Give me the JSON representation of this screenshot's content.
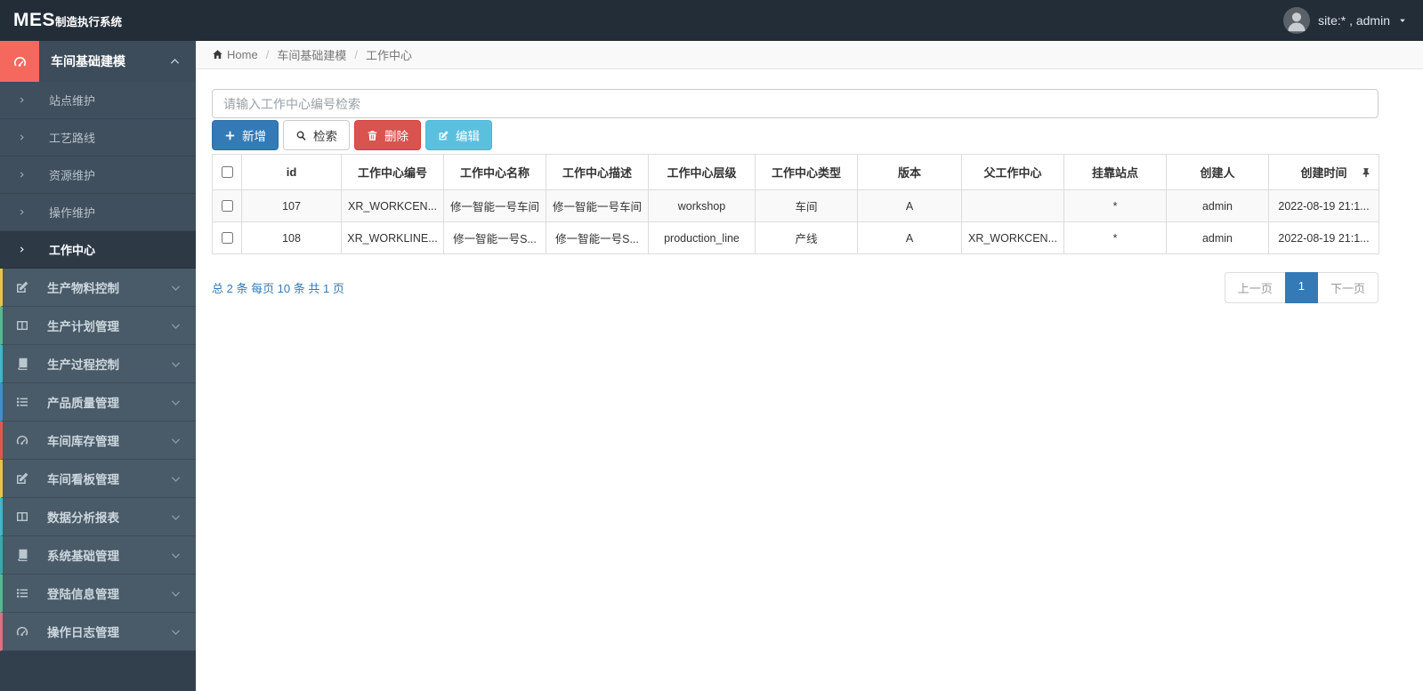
{
  "colors": {
    "primary": "#337ab7",
    "danger": "#d9534f",
    "info": "#5bc0de",
    "sidebar_active_icon": "#f4685e"
  },
  "navbar": {
    "logo_primary": "MES",
    "logo_secondary": "制造执行系统",
    "user_label": "site:* , admin"
  },
  "sidebar": {
    "parent_active": {
      "label": "车间基础建模"
    },
    "sub_items": [
      {
        "label": "站点维护",
        "active": false
      },
      {
        "label": "工艺路线",
        "active": false
      },
      {
        "label": "资源维护",
        "active": false
      },
      {
        "label": "操作维护",
        "active": false
      },
      {
        "label": "工作中心",
        "active": true
      }
    ],
    "menu_items": [
      {
        "label": "生产物料控制",
        "icon": "pencil-square-icon",
        "accent": "#e8c444"
      },
      {
        "label": "生产计划管理",
        "icon": "columns-icon",
        "accent": "#56b88d"
      },
      {
        "label": "生产过程控制",
        "icon": "book-icon",
        "accent": "#3fb6c9"
      },
      {
        "label": "产品质量管理",
        "icon": "list-icon",
        "accent": "#3f8fc9"
      },
      {
        "label": "车间库存管理",
        "icon": "gauge-icon",
        "accent": "#e2574c"
      },
      {
        "label": "车间看板管理",
        "icon": "pencil-square-icon",
        "accent": "#e8c444"
      },
      {
        "label": "数据分析报表",
        "icon": "columns-icon",
        "accent": "#3fb6c9"
      },
      {
        "label": "系统基础管理",
        "icon": "book-icon",
        "accent": "#3aa9a9"
      },
      {
        "label": "登陆信息管理",
        "icon": "list-icon",
        "accent": "#56b88d"
      },
      {
        "label": "操作日志管理",
        "icon": "gauge-icon",
        "accent": "#e2707f"
      }
    ]
  },
  "breadcrumb": {
    "home_label": "Home",
    "separator": "/",
    "section": "车间基础建模",
    "current": "工作中心"
  },
  "search": {
    "placeholder": "请输入工作中心编号检索",
    "value": ""
  },
  "toolbar": {
    "add_label": "新增",
    "search_label": "检索",
    "delete_label": "删除",
    "edit_label": "编辑"
  },
  "table": {
    "headers": [
      "id",
      "工作中心编号",
      "工作中心名称",
      "工作中心描述",
      "工作中心层级",
      "工作中心类型",
      "版本",
      "父工作中心",
      "挂靠站点",
      "创建人",
      "创建时间"
    ],
    "rows": [
      {
        "cells": [
          "107",
          "XR_WORKCEN...",
          "修一智能一号车间",
          "修一智能一号车间",
          "workshop",
          "车间",
          "A",
          "",
          "*",
          "admin",
          "2022-08-19 21:1..."
        ]
      },
      {
        "cells": [
          "108",
          "XR_WORKLINE...",
          "修一智能一号S...",
          "修一智能一号S...",
          "production_line",
          "产线",
          "A",
          "XR_WORKCEN...",
          "*",
          "admin",
          "2022-08-19 21:1..."
        ]
      }
    ]
  },
  "footer": {
    "summary": "总 2 条  每页 10 条  共 1 页"
  },
  "pagination": {
    "prev": "上一页",
    "current": "1",
    "next": "下一页"
  }
}
